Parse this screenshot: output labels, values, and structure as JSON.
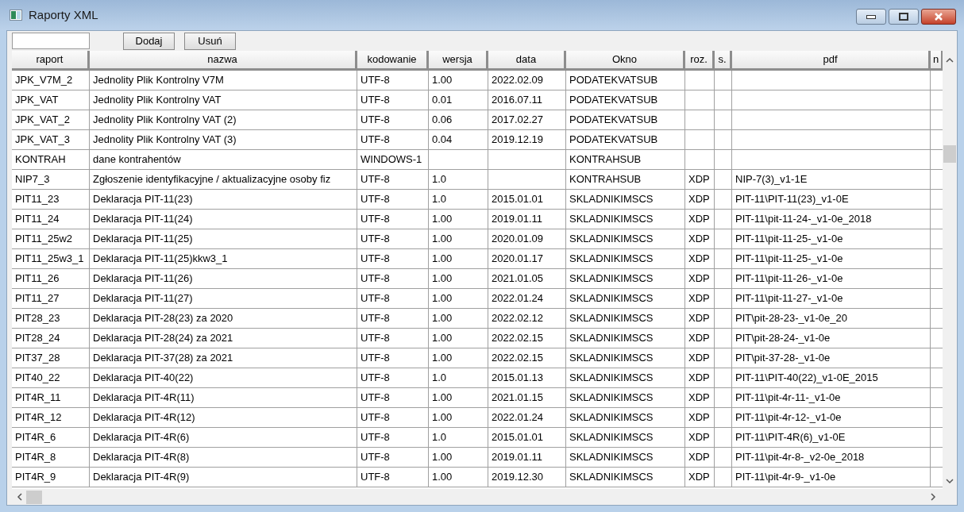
{
  "window": {
    "title": "Raporty XML"
  },
  "toolbar": {
    "buttons": [
      "Dodaj",
      "Usuń"
    ]
  },
  "table": {
    "columns": [
      "raport",
      "nazwa",
      "kodowanie",
      "wersja",
      "data",
      "Okno",
      "roz.",
      "s.",
      "pdf",
      "n"
    ],
    "rows": [
      {
        "cells": [
          "JPK_V7M_2",
          "Jednolity Plik Kontrolny V7M",
          "UTF-8",
          "1.00",
          "2022.02.09",
          "PODATEKVATSUB",
          null,
          null,
          null
        ]
      },
      {
        "cells": [
          "JPK_VAT",
          "Jednolity Plik Kontrolny VAT",
          "UTF-8",
          "0.01",
          "2016.07.11",
          "PODATEKVATSUB",
          null,
          null,
          null
        ]
      },
      {
        "cells": [
          "JPK_VAT_2",
          "Jednolity Plik Kontrolny VAT (2)",
          "UTF-8",
          "0.06",
          "2017.02.27",
          "PODATEKVATSUB",
          null,
          null,
          null
        ]
      },
      {
        "cells": [
          "JPK_VAT_3",
          "Jednolity Plik Kontrolny VAT (3)",
          "UTF-8",
          "0.04",
          "2019.12.19",
          "PODATEKVATSUB",
          null,
          null,
          null
        ]
      },
      {
        "cells": [
          "KONTRAH",
          "dane kontrahentów",
          "WINDOWS-1",
          null,
          null,
          "KONTRAHSUB",
          null,
          null,
          null
        ]
      },
      {
        "cells": [
          "NIP7_3",
          "Zgłoszenie identyfikacyjne / aktualizacyjne osoby fiz",
          "UTF-8",
          "1.0",
          null,
          "KONTRAHSUB",
          "XDP",
          null,
          "NIP-7(3)_v1-1E"
        ]
      },
      {
        "cells": [
          "PIT11_23",
          "Deklaracja PIT-11(23)",
          "UTF-8",
          "1.0",
          "2015.01.01",
          "SKLADNIKIMSCS",
          "XDP",
          null,
          "PIT-11\\PIT-11(23)_v1-0E"
        ]
      },
      {
        "cells": [
          "PIT11_24",
          "Deklaracja PIT-11(24)",
          "UTF-8",
          "1.00",
          "2019.01.11",
          "SKLADNIKIMSCS",
          "XDP",
          null,
          "PIT-11\\pit-11-24-_v1-0e_2018"
        ]
      },
      {
        "cells": [
          "PIT11_25w2",
          "Deklaracja PIT-11(25)",
          "UTF-8",
          "1.00",
          "2020.01.09",
          "SKLADNIKIMSCS",
          "XDP",
          null,
          "PIT-11\\pit-11-25-_v1-0e"
        ]
      },
      {
        "cells": [
          "PIT11_25w3_1",
          "Deklaracja PIT-11(25)kkw3_1",
          "UTF-8",
          "1.00",
          "2020.01.17",
          "SKLADNIKIMSCS",
          "XDP",
          null,
          "PIT-11\\pit-11-25-_v1-0e"
        ]
      },
      {
        "cells": [
          "PIT11_26",
          "Deklaracja PIT-11(26)",
          "UTF-8",
          "1.00",
          "2021.01.05",
          "SKLADNIKIMSCS",
          "XDP",
          null,
          "PIT-11\\pit-11-26-_v1-0e"
        ]
      },
      {
        "cells": [
          "PIT11_27",
          "Deklaracja PIT-11(27)",
          "UTF-8",
          "1.00",
          "2022.01.24",
          "SKLADNIKIMSCS",
          "XDP",
          null,
          "PIT-11\\pit-11-27-_v1-0e"
        ]
      },
      {
        "cells": [
          "PIT28_23",
          "Deklaracja PIT-28(23) za 2020",
          "UTF-8",
          "1.00",
          "2022.02.12",
          "SKLADNIKIMSCS",
          "XDP",
          null,
          "PIT\\pit-28-23-_v1-0e_20"
        ]
      },
      {
        "cells": [
          "PIT28_24",
          "Deklaracja PIT-28(24) za 2021",
          "UTF-8",
          "1.00",
          "2022.02.15",
          "SKLADNIKIMSCS",
          "XDP",
          null,
          "PIT\\pit-28-24-_v1-0e"
        ]
      },
      {
        "cells": [
          "PIT37_28",
          "Deklaracja PIT-37(28) za 2021",
          "UTF-8",
          "1.00",
          "2022.02.15",
          "SKLADNIKIMSCS",
          "XDP",
          null,
          "PIT\\pit-37-28-_v1-0e"
        ]
      },
      {
        "cells": [
          "PIT40_22",
          "Deklaracja PIT-40(22)",
          "UTF-8",
          "1.0",
          "2015.01.13",
          "SKLADNIKIMSCS",
          "XDP",
          null,
          "PIT-11\\PIT-40(22)_v1-0E_2015"
        ]
      },
      {
        "cells": [
          "PIT4R_11",
          "Deklaracja PIT-4R(11)",
          "UTF-8",
          "1.00",
          "2021.01.15",
          "SKLADNIKIMSCS",
          "XDP",
          null,
          "PIT-11\\pit-4r-11-_v1-0e"
        ]
      },
      {
        "cells": [
          "PIT4R_12",
          "Deklaracja PIT-4R(12)",
          "UTF-8",
          "1.00",
          "2022.01.24",
          "SKLADNIKIMSCS",
          "XDP",
          null,
          "PIT-11\\pit-4r-12-_v1-0e"
        ]
      },
      {
        "cells": [
          "PIT4R_6",
          "Deklaracja PIT-4R(6)",
          "UTF-8",
          "1.0",
          "2015.01.01",
          "SKLADNIKIMSCS",
          "XDP",
          null,
          "PIT-11\\PIT-4R(6)_v1-0E"
        ]
      },
      {
        "cells": [
          "PIT4R_8",
          "Deklaracja PIT-4R(8)",
          "UTF-8",
          "1.00",
          "2019.01.11",
          "SKLADNIKIMSCS",
          "XDP",
          null,
          "PIT-11\\pit-4r-8-_v2-0e_2018"
        ]
      },
      {
        "cells": [
          "PIT4R_9",
          "Deklaracja PIT-4R(9)",
          "UTF-8",
          "1.00",
          "2019.12.30",
          "SKLADNIKIMSCS",
          "XDP",
          null,
          "PIT-11\\pit-4r-9-_v1-0e"
        ]
      }
    ]
  }
}
